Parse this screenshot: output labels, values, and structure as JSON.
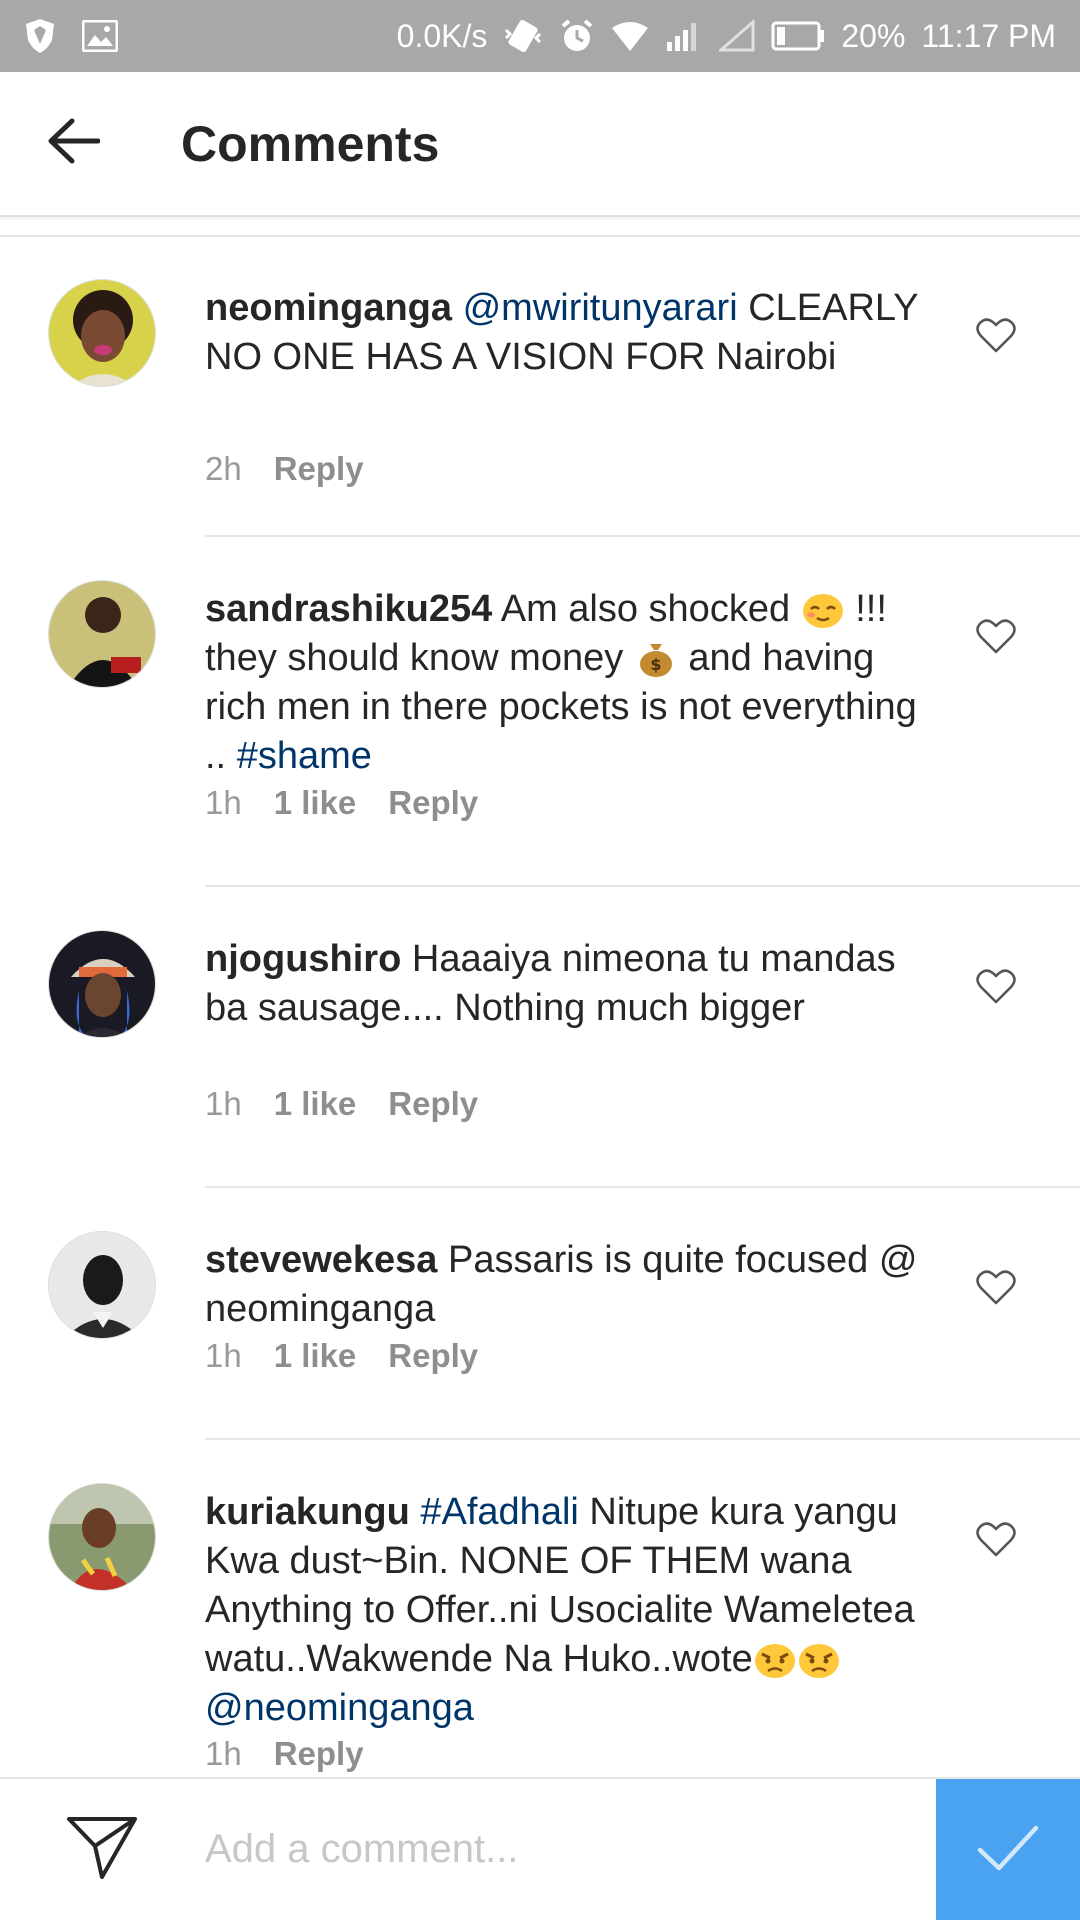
{
  "status_bar": {
    "network_speed": "0.0K/s",
    "battery": "20%",
    "time": "11:17 PM",
    "icons": [
      "shield-icon",
      "image-icon",
      "vibrate-icon",
      "alarm-icon",
      "wifi-icon",
      "signal-icon",
      "signal-empty-icon",
      "battery-icon"
    ]
  },
  "header": {
    "title": "Comments",
    "back_icon": "back-arrow-icon"
  },
  "colors": {
    "link": "#003569",
    "meta": "#999999",
    "accent": "#4aa3f0",
    "status_bar": "#a8a8a8"
  },
  "comments": [
    {
      "username": "neominganga",
      "text_parts": [
        {
          "type": "mention",
          "text": "@mwiritunyarari"
        },
        {
          "type": "text",
          "text": " CLEARLY NO ONE HAS A VISION FOR Nairobi"
        }
      ],
      "time": "2h",
      "likes": "",
      "reply": "Reply"
    },
    {
      "username": "sandrashiku254",
      "text_parts": [
        {
          "type": "text",
          "text": " Am also shocked "
        },
        {
          "type": "emoji",
          "name": "relieved-face-emoji"
        },
        {
          "type": "text",
          "text": " !!! they should know money "
        },
        {
          "type": "emoji",
          "name": "money-bag-emoji"
        },
        {
          "type": "text",
          "text": " and having rich men in there pockets is not everything .. "
        },
        {
          "type": "hashtag",
          "text": "#shame"
        }
      ],
      "time": "1h",
      "likes": "1 like",
      "reply": "Reply"
    },
    {
      "username": "njogushiro",
      "text_parts": [
        {
          "type": "text",
          "text": " Haaaiya nimeona tu mandas ba sausage.... Nothing much bigger"
        }
      ],
      "time": "1h",
      "likes": "1 like",
      "reply": "Reply"
    },
    {
      "username": "stevewekesa",
      "text_parts": [
        {
          "type": "text",
          "text": " Passaris is quite focused @ neominganga"
        }
      ],
      "time": "1h",
      "likes": "1 like",
      "reply": "Reply"
    },
    {
      "username": "kuriakungu",
      "text_parts": [
        {
          "type": "text",
          "text": " "
        },
        {
          "type": "hashtag",
          "text": "#Afadhali"
        },
        {
          "type": "text",
          "text": " Nitupe kura yangu Kwa dust~Bin. NONE OF THEM wana Anything to Offer..ni Usocialite Wameletea watu..Wakwende Na Huko..wote"
        },
        {
          "type": "emoji",
          "name": "angry-face-emoji"
        },
        {
          "type": "emoji",
          "name": "angry-face-emoji"
        },
        {
          "type": "text",
          "text": " "
        },
        {
          "type": "mention",
          "text": "@neominganga"
        }
      ],
      "time": "1h",
      "likes": "",
      "reply": "Reply"
    }
  ],
  "composer": {
    "placeholder": "Add a comment...",
    "value": "",
    "send_icon": "paper-plane-icon",
    "post_icon": "checkmark-icon"
  }
}
